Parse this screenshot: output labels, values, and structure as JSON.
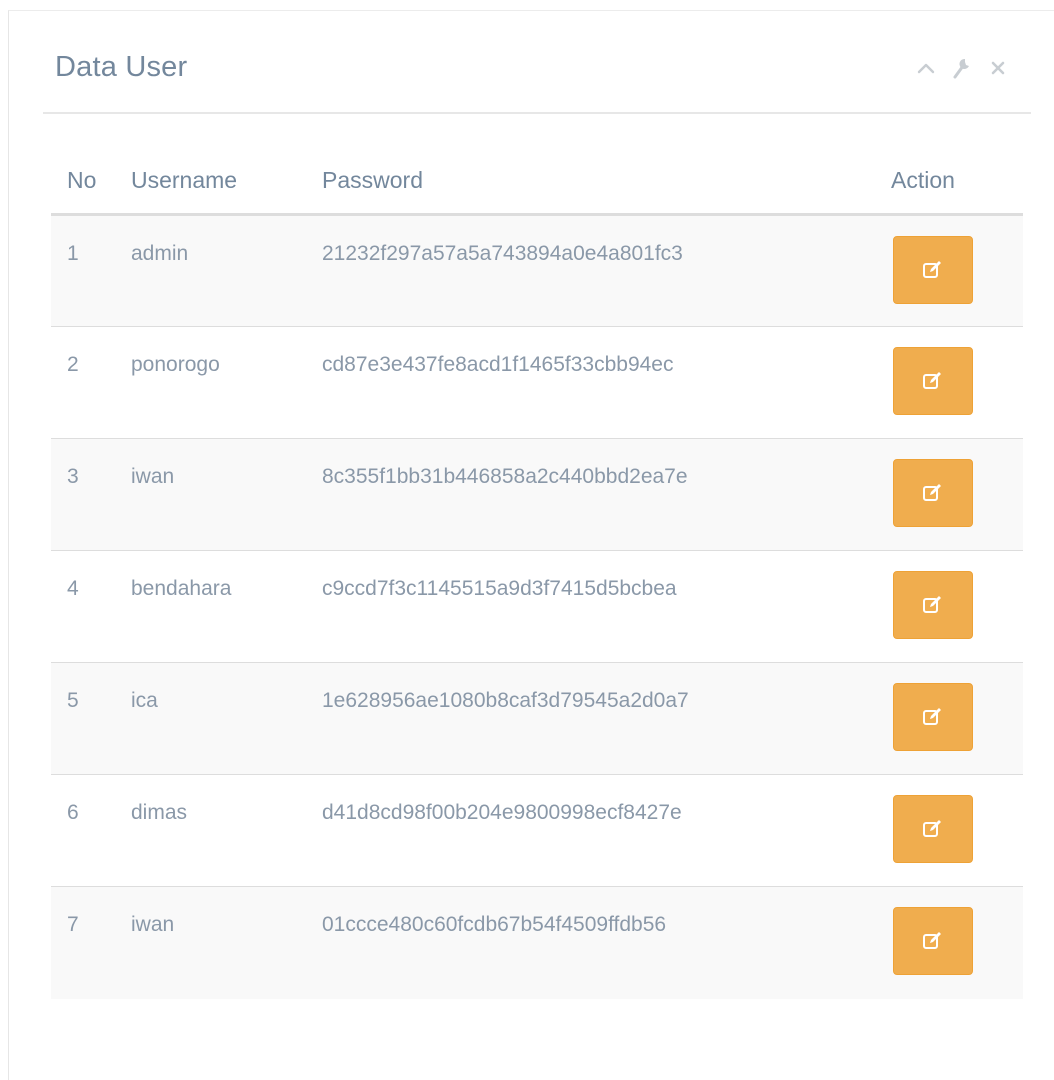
{
  "panel": {
    "title": "Data User",
    "tools": [
      "chevron-up-icon",
      "wrench-icon",
      "close-icon"
    ]
  },
  "table": {
    "headers": {
      "no": "No",
      "username": "Username",
      "password": "Password",
      "action": "Action"
    },
    "rows": [
      {
        "no": "1",
        "username": "admin",
        "password": "21232f297a57a5a743894a0e4a801fc3"
      },
      {
        "no": "2",
        "username": "ponorogo",
        "password": "cd87e3e437fe8acd1f1465f33cbb94ec"
      },
      {
        "no": "3",
        "username": "iwan",
        "password": "8c355f1bb31b446858a2c440bbd2ea7e"
      },
      {
        "no": "4",
        "username": "bendahara",
        "password": "c9ccd7f3c1145515a9d3f7415d5bcbea"
      },
      {
        "no": "5",
        "username": "ica",
        "password": "1e628956ae1080b8caf3d79545a2d0a7"
      },
      {
        "no": "6",
        "username": "dimas",
        "password": "d41d8cd98f00b204e9800998ecf8427e"
      },
      {
        "no": "7",
        "username": "iwan",
        "password": "01ccce480c60fcdb67b54f4509ffdb56"
      }
    ],
    "action_icon": "edit-icon"
  },
  "colors": {
    "title": "#73879c",
    "text": "#8a98a8",
    "edit_button": "#f0ad4e",
    "stripe": "#f9f9f9",
    "border": "#dddddd"
  }
}
